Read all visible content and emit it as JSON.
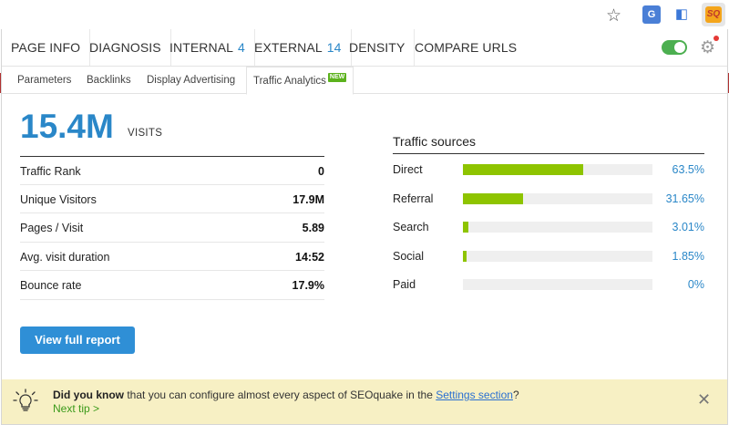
{
  "browser": {
    "star_icon": "star-icon",
    "extensions": [
      {
        "name": "translate-extension-icon",
        "label": "G"
      },
      {
        "name": "tag-extension-icon",
        "label": "◧"
      },
      {
        "name": "seoquake-extension-icon",
        "label": "SQ"
      }
    ]
  },
  "topnav": {
    "tabs": [
      {
        "label": "PAGE INFO",
        "count": ""
      },
      {
        "label": "DIAGNOSIS",
        "count": ""
      },
      {
        "label": "INTERNAL",
        "count": "4"
      },
      {
        "label": "EXTERNAL",
        "count": "14"
      },
      {
        "label": "DENSITY",
        "count": ""
      },
      {
        "label": "COMPARE URLS",
        "count": ""
      }
    ],
    "toggle_on": true
  },
  "subtabs": {
    "items": [
      "Parameters",
      "Backlinks",
      "Display Advertising",
      "Traffic Analytics"
    ],
    "active": "Traffic Analytics",
    "new_badge": "NEW"
  },
  "visits": {
    "number": "15.4M",
    "label": "VISITS"
  },
  "stats": [
    {
      "label": "Traffic Rank",
      "value": "0"
    },
    {
      "label": "Unique Visitors",
      "value": "17.9M"
    },
    {
      "label": "Pages / Visit",
      "value": "5.89"
    },
    {
      "label": "Avg. visit duration",
      "value": "14:52"
    },
    {
      "label": "Bounce rate",
      "value": "17.9%"
    }
  ],
  "traffic_sources": {
    "title": "Traffic sources",
    "items": [
      {
        "label": "Direct",
        "percent_text": "63.5%",
        "percent": 63.5
      },
      {
        "label": "Referral",
        "percent_text": "31.65%",
        "percent": 31.65
      },
      {
        "label": "Search",
        "percent_text": "3.01%",
        "percent": 3.01
      },
      {
        "label": "Social",
        "percent_text": "1.85%",
        "percent": 1.85
      },
      {
        "label": "Paid",
        "percent_text": "0%",
        "percent": 0
      }
    ],
    "bar_color": "#8ec400"
  },
  "report_button": {
    "label": "View full report"
  },
  "tip": {
    "bold": "Did you know",
    "text": "that you can configure almost every aspect of SEOquake in the",
    "link": "Settings section",
    "suffix": "?",
    "next": "Next tip >",
    "close": "✕"
  },
  "colors": {
    "accent": "#2a87c8",
    "button": "#2f8fd6",
    "tip_bg": "#f7f0c4",
    "toggle": "#4caf50"
  }
}
